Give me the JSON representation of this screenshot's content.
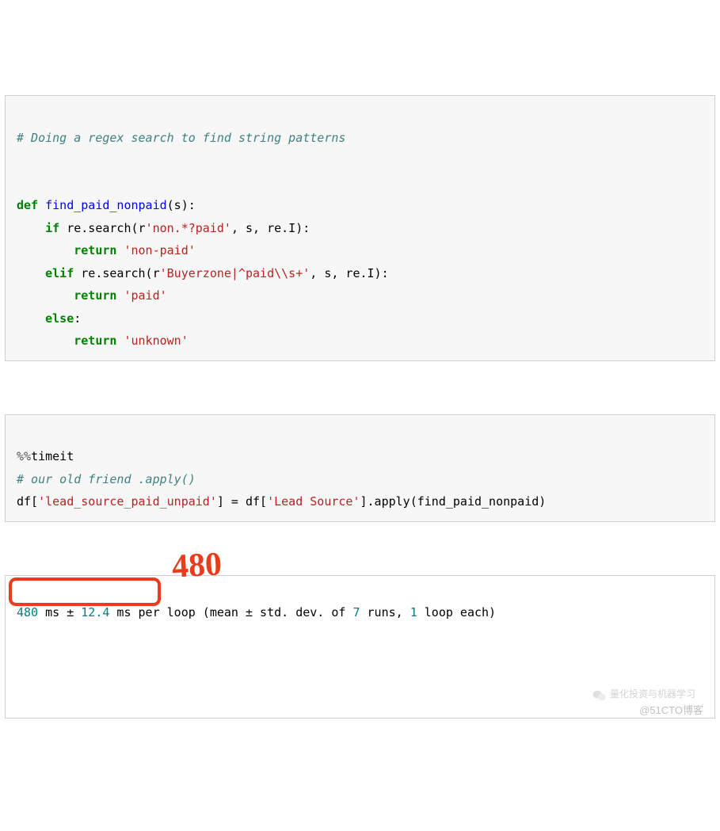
{
  "cell1": {
    "comment": "# Doing a regex search to find string patterns",
    "kw_def": "def",
    "fn_name": "find_paid_nonpaid",
    "sig_tail": "(s):",
    "kw_if": "if",
    "pre_search1": " re.search(r",
    "str_regex1": "'non.*?paid'",
    "post_search1": ", s, re.I):",
    "kw_return": "return",
    "str_nonpaid": "'non-paid'",
    "kw_elif": "elif",
    "pre_search2": " re.search(r",
    "str_regex2": "'Buyerzone|^paid\\\\s+'",
    "post_search2": ", s, re.I):",
    "str_paid": "'paid'",
    "kw_else": "else",
    "colon": ":",
    "str_unknown": "'unknown'"
  },
  "cell2": {
    "magic": "%%",
    "magic_cmd": "timeit",
    "comment": "# our old friend .apply()",
    "pre1": "df[",
    "str_col1": "'lead_source_paid_unpaid'",
    "mid": "] = df[",
    "str_col2": "'Lead Source'",
    "tail": "].apply(find_paid_nonpaid)"
  },
  "output": {
    "num1": "480",
    "txt1": " ms ± ",
    "num2": "12.4",
    "txt2": " ms per loop (mean ± std. dev. of ",
    "num3": "7",
    "txt3": " runs, ",
    "num4": "1",
    "txt4": " loop each)"
  },
  "annotations": {
    "handwritten": "480",
    "wm1": "量化投资与机器学习",
    "wm2": "@51CTO博客"
  }
}
